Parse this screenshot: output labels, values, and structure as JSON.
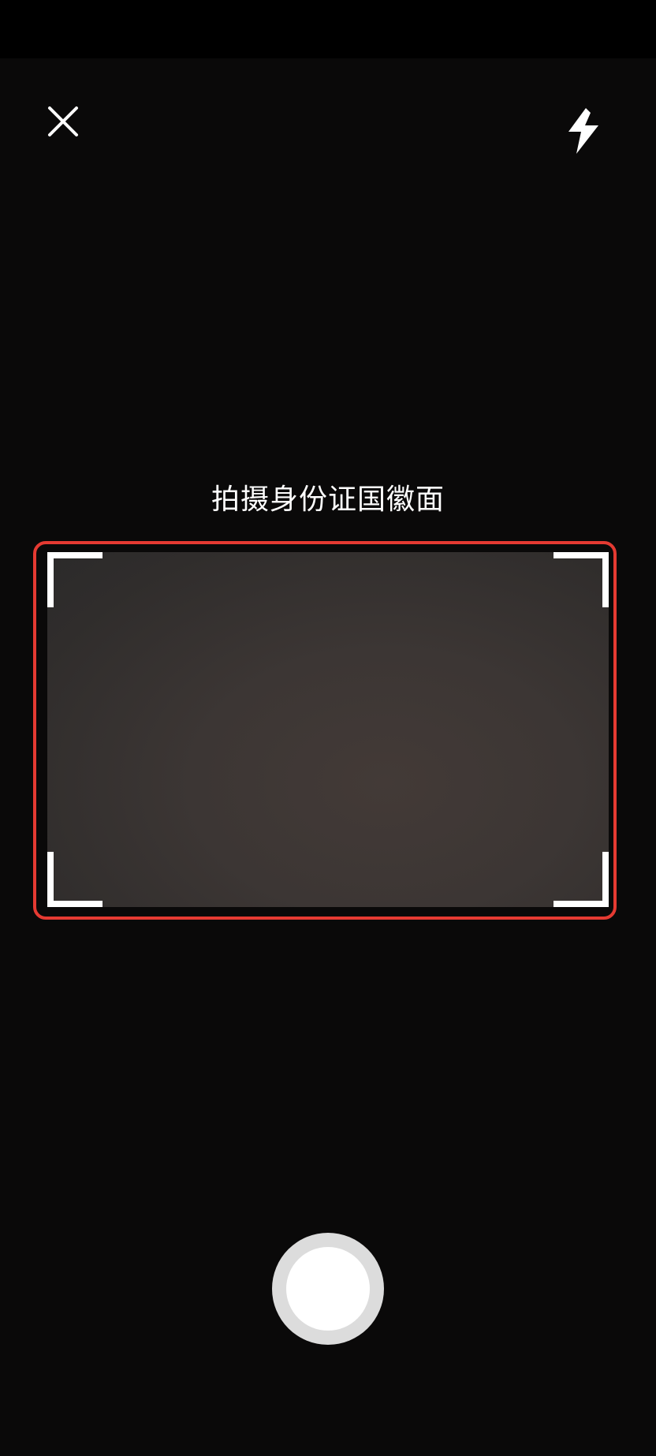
{
  "header": {
    "close_icon": "close-icon",
    "flash_icon": "flash-icon"
  },
  "camera": {
    "instruction": "拍摄身份证国徽面",
    "frame_color": "#e53a32",
    "corner_color": "#ffffff"
  },
  "controls": {
    "shutter_icon": "shutter-button"
  }
}
